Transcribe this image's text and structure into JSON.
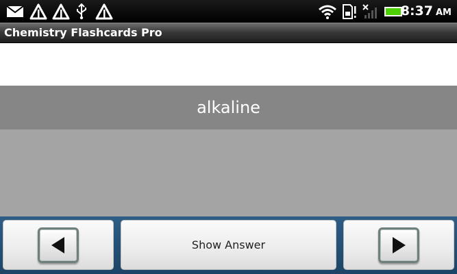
{
  "status_bar": {
    "left_icons": [
      "mail-icon",
      "warning-icon",
      "warning-icon",
      "usb-icon",
      "warning-icon"
    ],
    "right_icons": [
      "wifi-icon",
      "sdcard-icon",
      "no-signal-icon",
      "battery-icon"
    ],
    "time": "8:37",
    "ampm": "AM"
  },
  "app": {
    "title": "Chemistry Flashcards Pro"
  },
  "card": {
    "term": "alkaline"
  },
  "controls": {
    "prev_icon": "left-arrow-icon",
    "show_answer_label": "Show Answer",
    "next_icon": "right-arrow-icon"
  },
  "colors": {
    "term_band": "#868686",
    "card_area": "#a4a4a4",
    "bottom_bar": "#2e5d86",
    "battery": "#4cd000"
  }
}
